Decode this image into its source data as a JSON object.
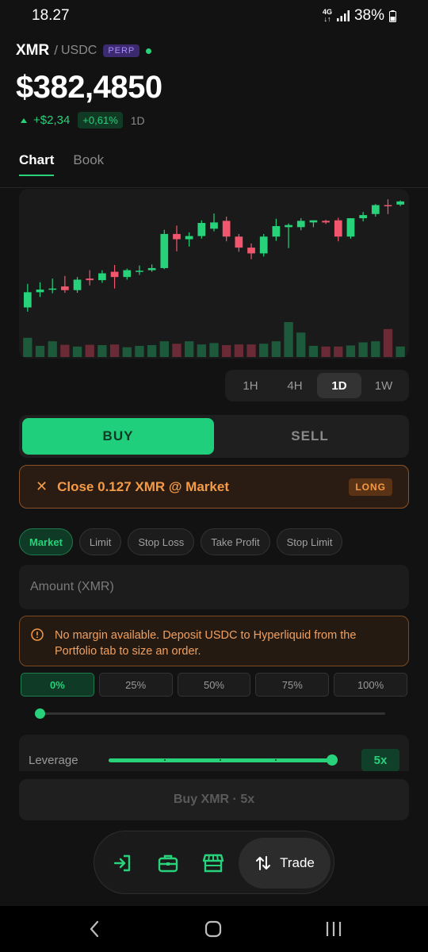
{
  "status_bar": {
    "time": "18.27",
    "network_top": "4G",
    "network_bottom": "↓↑",
    "battery": "38%"
  },
  "pair": {
    "base": "XMR",
    "separator": "/",
    "quote": "USDC",
    "badge": "PERP"
  },
  "price": "$382,4850",
  "change": {
    "absolute": "+$2,34",
    "percent": "+0,61%",
    "period": "1D"
  },
  "tabs": [
    {
      "label": "Chart",
      "active": true
    },
    {
      "label": "Book",
      "active": false
    }
  ],
  "timeframes": [
    {
      "label": "1H",
      "active": false
    },
    {
      "label": "4H",
      "active": false
    },
    {
      "label": "1D",
      "active": true
    },
    {
      "label": "1W",
      "active": false
    }
  ],
  "side": {
    "buy": "BUY",
    "sell": "SELL",
    "selected": "BUY"
  },
  "close_banner": {
    "text": "Close 0.127 XMR @ Market",
    "badge": "LONG"
  },
  "order_types": [
    {
      "label": "Market",
      "active": true
    },
    {
      "label": "Limit",
      "active": false
    },
    {
      "label": "Stop Loss",
      "active": false
    },
    {
      "label": "Take Profit",
      "active": false
    },
    {
      "label": "Stop Limit",
      "active": false
    }
  ],
  "amount": {
    "placeholder": "Amount (XMR)",
    "value": ""
  },
  "warning": "No margin available. Deposit USDC to Hyperliquid from the Portfolio tab to size an order.",
  "percent_buttons": [
    {
      "label": "0%",
      "active": true
    },
    {
      "label": "25%",
      "active": false
    },
    {
      "label": "50%",
      "active": false
    },
    {
      "label": "75%",
      "active": false
    },
    {
      "label": "100%",
      "active": false
    }
  ],
  "size_slider": {
    "fraction": 0
  },
  "leverage": {
    "label": "Leverage",
    "value": "5x",
    "fraction": 1
  },
  "submit": "Buy XMR · 5x",
  "bottom_nav": {
    "trade_label": "Trade",
    "icons": [
      "login-icon",
      "briefcase-icon",
      "store-icon",
      "swap-vertical-icon"
    ]
  },
  "colors": {
    "up": "#27d27a",
    "down": "#f0566e",
    "accent": "#1fcf7c",
    "warning": "#f59a45",
    "perp": "#a98cff"
  },
  "chart_data": {
    "type": "candlestick",
    "candles": [
      {
        "o": 366.0,
        "h": 370.5,
        "l": 365.2,
        "c": 368.9
      },
      {
        "o": 368.9,
        "h": 370.8,
        "l": 368.0,
        "c": 369.4
      },
      {
        "o": 369.4,
        "h": 371.5,
        "l": 368.7,
        "c": 369.6
      },
      {
        "o": 370.0,
        "h": 372.0,
        "l": 368.8,
        "c": 369.3
      },
      {
        "o": 369.3,
        "h": 371.8,
        "l": 368.8,
        "c": 371.3
      },
      {
        "o": 371.5,
        "h": 373.1,
        "l": 370.2,
        "c": 371.2
      },
      {
        "o": 371.2,
        "h": 373.1,
        "l": 370.7,
        "c": 372.5
      },
      {
        "o": 372.8,
        "h": 374.1,
        "l": 369.6,
        "c": 371.8
      },
      {
        "o": 371.8,
        "h": 373.4,
        "l": 371.3,
        "c": 373.1
      },
      {
        "o": 373.0,
        "h": 374.0,
        "l": 372.2,
        "c": 373.0
      },
      {
        "o": 373.1,
        "h": 374.2,
        "l": 372.8,
        "c": 373.5
      },
      {
        "o": 373.5,
        "h": 380.8,
        "l": 373.3,
        "c": 380.0
      },
      {
        "o": 380.0,
        "h": 381.6,
        "l": 376.7,
        "c": 379.0
      },
      {
        "o": 379.0,
        "h": 380.3,
        "l": 377.6,
        "c": 379.6
      },
      {
        "o": 379.6,
        "h": 382.6,
        "l": 379.1,
        "c": 382.1
      },
      {
        "o": 381.0,
        "h": 383.9,
        "l": 380.5,
        "c": 382.2
      },
      {
        "o": 382.5,
        "h": 383.3,
        "l": 378.6,
        "c": 379.5
      },
      {
        "o": 379.5,
        "h": 380.0,
        "l": 376.6,
        "c": 377.4
      },
      {
        "o": 377.4,
        "h": 378.2,
        "l": 375.2,
        "c": 376.3
      },
      {
        "o": 376.3,
        "h": 380.0,
        "l": 375.7,
        "c": 379.5
      },
      {
        "o": 379.5,
        "h": 382.9,
        "l": 378.7,
        "c": 381.5
      },
      {
        "o": 381.3,
        "h": 382.0,
        "l": 377.3,
        "c": 381.7
      },
      {
        "o": 381.3,
        "h": 383.0,
        "l": 380.7,
        "c": 382.5
      },
      {
        "o": 382.2,
        "h": 382.6,
        "l": 381.3,
        "c": 382.6
      },
      {
        "o": 382.5,
        "h": 382.7,
        "l": 381.9,
        "c": 382.2
      },
      {
        "o": 382.6,
        "h": 383.1,
        "l": 378.6,
        "c": 379.5
      },
      {
        "o": 379.5,
        "h": 383.0,
        "l": 379.1,
        "c": 383.0
      },
      {
        "o": 383.0,
        "h": 384.2,
        "l": 382.4,
        "c": 383.6
      },
      {
        "o": 383.8,
        "h": 385.7,
        "l": 383.3,
        "c": 385.5
      },
      {
        "o": 385.5,
        "h": 386.6,
        "l": 383.8,
        "c": 385.4
      },
      {
        "o": 385.6,
        "h": 386.4,
        "l": 385.3,
        "c": 386.2
      }
    ],
    "volumes": [
      0.55,
      0.32,
      0.45,
      0.35,
      0.3,
      0.35,
      0.34,
      0.36,
      0.28,
      0.32,
      0.34,
      0.45,
      0.38,
      0.45,
      0.36,
      0.4,
      0.34,
      0.36,
      0.36,
      0.38,
      0.45,
      1.0,
      0.7,
      0.32,
      0.3,
      0.3,
      0.33,
      0.42,
      0.45,
      0.8,
      0.3
    ],
    "ylim": [
      362.0,
      388.0
    ],
    "grid": false
  }
}
